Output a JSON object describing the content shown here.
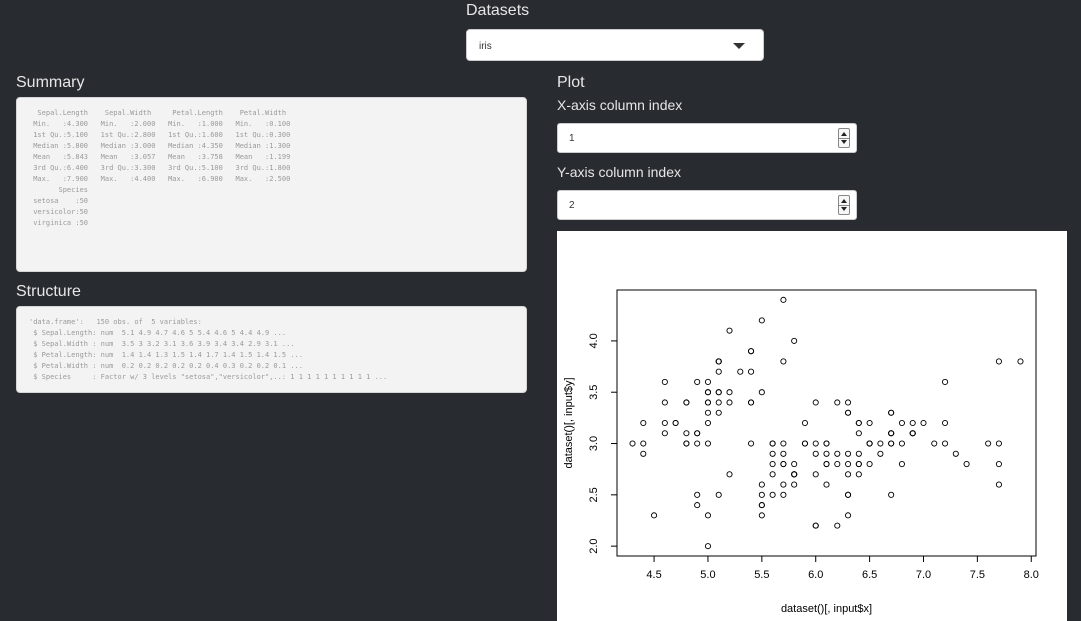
{
  "datasets": {
    "label": "Datasets",
    "selected": "iris"
  },
  "summary": {
    "title": "Summary",
    "text": "  Sepal.Length    Sepal.Width     Petal.Length    Petal.Width   \n Min.   :4.300   Min.   :2.000   Min.   :1.000   Min.   :0.100  \n 1st Qu.:5.100   1st Qu.:2.800   1st Qu.:1.600   1st Qu.:0.300  \n Median :5.800   Median :3.000   Median :4.350   Median :1.300  \n Mean   :5.843   Mean   :3.057   Mean   :3.758   Mean   :1.199  \n 3rd Qu.:6.400   3rd Qu.:3.300   3rd Qu.:5.100   3rd Qu.:1.800  \n Max.   :7.900   Max.   :4.400   Max.   :6.900   Max.   :2.500  \n       Species  \n setosa    :50  \n versicolor:50  \n virginica :50  "
  },
  "structure": {
    "title": "Structure",
    "text": "'data.frame':\t150 obs. of  5 variables:\n $ Sepal.Length: num  5.1 4.9 4.7 4.6 5 5.4 4.6 5 4.4 4.9 ...\n $ Sepal.Width : num  3.5 3 3.2 3.1 3.6 3.9 3.4 3.4 2.9 3.1 ...\n $ Petal.Length: num  1.4 1.4 1.3 1.5 1.4 1.7 1.4 1.5 1.4 1.5 ...\n $ Petal.Width : num  0.2 0.2 0.2 0.2 0.2 0.4 0.3 0.2 0.2 0.1 ...\n $ Species     : Factor w/ 3 levels \"setosa\",\"versicolor\",..: 1 1 1 1 1 1 1 1 1 1 ..."
  },
  "plot": {
    "title": "Plot",
    "x_input": {
      "label": "X-axis column index",
      "value": "1"
    },
    "y_input": {
      "label": "Y-axis column index",
      "value": "2"
    }
  },
  "chart_data": {
    "type": "scatter",
    "xlabel": "dataset()[, input$x]",
    "ylabel": "dataset()[, input$y]",
    "xlim": [
      4.3,
      7.9
    ],
    "ylim": [
      2.0,
      4.4
    ],
    "xticks": [
      "4.5",
      "5.0",
      "5.5",
      "6.0",
      "6.5",
      "7.0",
      "7.5",
      "8.0"
    ],
    "yticks": [
      "2.0",
      "2.5",
      "3.0",
      "3.5",
      "4.0"
    ],
    "x": [
      5.1,
      4.9,
      4.7,
      4.6,
      5.0,
      5.4,
      4.6,
      5.0,
      4.4,
      4.9,
      5.4,
      4.8,
      4.8,
      4.3,
      5.8,
      5.7,
      5.4,
      5.1,
      5.7,
      5.1,
      5.4,
      5.1,
      4.6,
      5.1,
      4.8,
      5.0,
      5.0,
      5.2,
      5.2,
      4.7,
      4.8,
      5.4,
      5.2,
      5.5,
      4.9,
      5.0,
      5.5,
      4.9,
      4.4,
      5.1,
      5.0,
      4.5,
      4.4,
      5.0,
      5.1,
      4.8,
      5.1,
      4.6,
      5.3,
      5.0,
      7.0,
      6.4,
      6.9,
      5.5,
      6.5,
      5.7,
      6.3,
      4.9,
      6.6,
      5.2,
      5.0,
      5.9,
      6.0,
      6.1,
      5.6,
      6.7,
      5.6,
      5.8,
      6.2,
      5.6,
      5.9,
      6.1,
      6.3,
      6.1,
      6.4,
      6.6,
      6.8,
      6.7,
      6.0,
      5.7,
      5.5,
      5.5,
      5.8,
      6.0,
      5.4,
      6.0,
      6.7,
      6.3,
      5.6,
      5.5,
      5.5,
      6.1,
      5.8,
      5.0,
      5.6,
      5.7,
      5.7,
      6.2,
      5.1,
      5.7,
      6.3,
      5.8,
      7.1,
      6.3,
      6.5,
      7.6,
      4.9,
      7.3,
      6.7,
      7.2,
      6.5,
      6.4,
      6.8,
      5.7,
      5.8,
      6.4,
      6.5,
      7.7,
      7.7,
      6.0,
      6.9,
      5.6,
      7.7,
      6.3,
      6.7,
      7.2,
      6.2,
      6.1,
      6.4,
      7.2,
      7.4,
      7.9,
      6.4,
      6.3,
      6.1,
      7.7,
      6.3,
      6.4,
      6.0,
      6.9,
      6.7,
      6.9,
      5.8,
      6.8,
      6.7,
      6.7,
      6.3,
      6.5,
      6.2,
      5.9
    ],
    "y": [
      3.5,
      3.0,
      3.2,
      3.1,
      3.6,
      3.9,
      3.4,
      3.4,
      2.9,
      3.1,
      3.7,
      3.4,
      3.0,
      3.0,
      4.0,
      4.4,
      3.9,
      3.5,
      3.8,
      3.8,
      3.4,
      3.7,
      3.6,
      3.3,
      3.4,
      3.0,
      3.4,
      3.5,
      3.4,
      3.2,
      3.1,
      3.4,
      4.1,
      4.2,
      3.1,
      3.2,
      3.5,
      3.6,
      3.0,
      3.4,
      3.5,
      2.3,
      3.2,
      3.5,
      3.8,
      3.0,
      3.8,
      3.2,
      3.7,
      3.3,
      3.2,
      3.2,
      3.1,
      2.3,
      2.8,
      2.8,
      3.3,
      2.4,
      2.9,
      2.7,
      2.0,
      3.0,
      2.2,
      2.9,
      2.9,
      3.1,
      3.0,
      2.7,
      2.2,
      2.5,
      3.2,
      2.8,
      2.5,
      2.8,
      2.9,
      3.0,
      2.8,
      3.0,
      2.9,
      2.6,
      2.4,
      2.4,
      2.7,
      2.7,
      3.0,
      3.4,
      3.1,
      2.3,
      3.0,
      2.5,
      2.6,
      3.0,
      2.6,
      2.3,
      2.7,
      3.0,
      2.9,
      2.9,
      2.5,
      2.8,
      3.3,
      2.7,
      3.0,
      2.9,
      3.0,
      3.0,
      2.5,
      2.9,
      2.5,
      3.6,
      3.2,
      2.7,
      3.0,
      2.5,
      2.8,
      3.2,
      3.0,
      3.8,
      2.6,
      2.2,
      3.2,
      2.8,
      2.8,
      2.7,
      3.3,
      3.2,
      2.8,
      3.0,
      2.8,
      3.0,
      2.8,
      3.8,
      2.8,
      2.8,
      2.6,
      3.0,
      3.4,
      3.1,
      3.0,
      3.1,
      3.1,
      3.1,
      2.7,
      3.2,
      3.3,
      3.0,
      2.5,
      3.0,
      3.4,
      3.0
    ]
  }
}
